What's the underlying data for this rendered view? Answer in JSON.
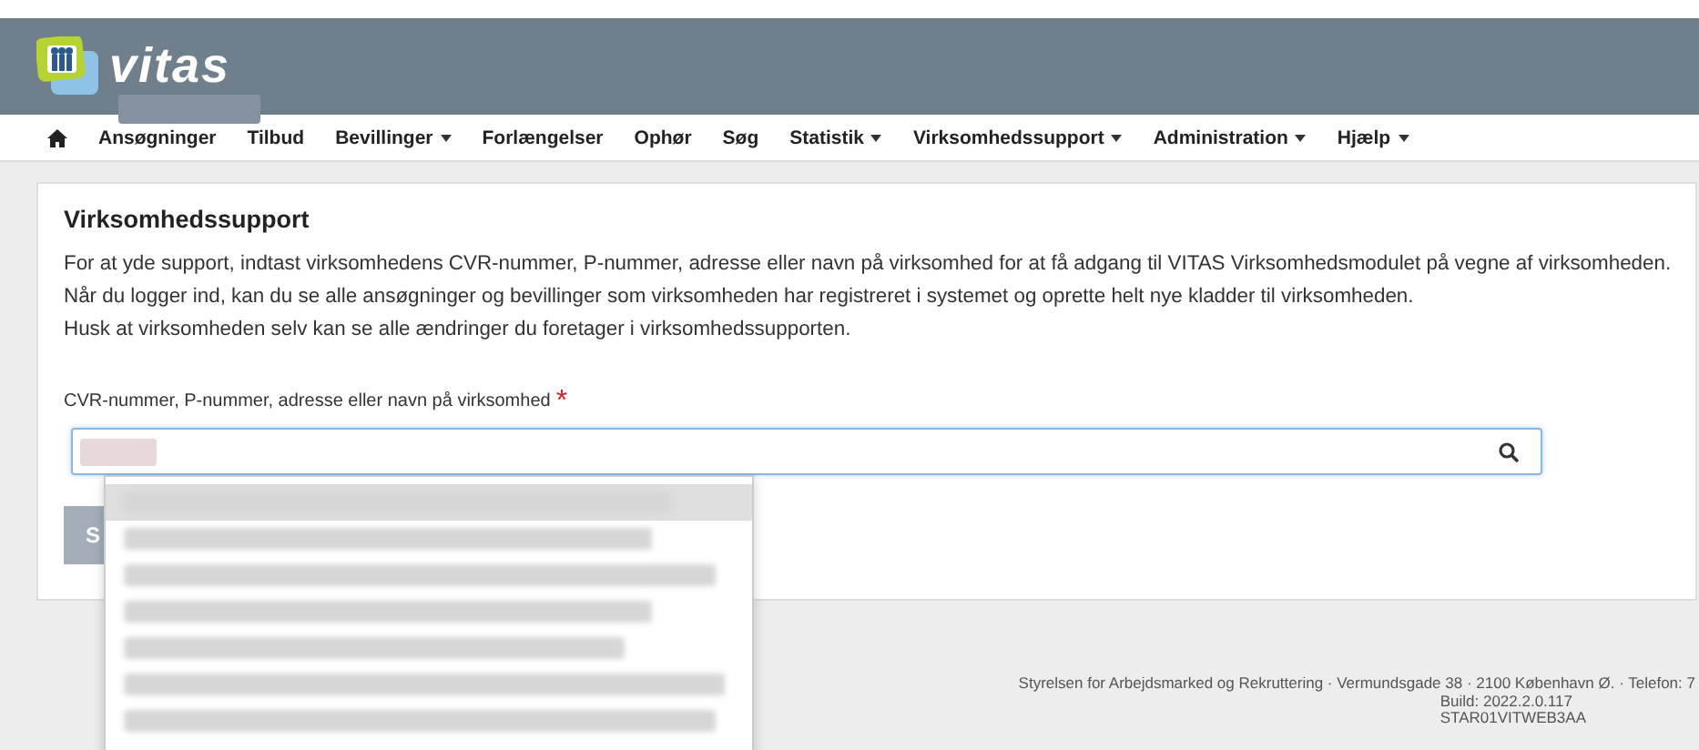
{
  "header": {
    "logo_text": "vitas"
  },
  "nav": [
    {
      "label": "Ansøgninger",
      "dropdown": false
    },
    {
      "label": "Tilbud",
      "dropdown": false
    },
    {
      "label": "Bevillinger",
      "dropdown": true
    },
    {
      "label": "Forlængelser",
      "dropdown": false
    },
    {
      "label": "Ophør",
      "dropdown": false
    },
    {
      "label": "Søg",
      "dropdown": false
    },
    {
      "label": "Statistik",
      "dropdown": true
    },
    {
      "label": "Virksomhedssupport",
      "dropdown": true
    },
    {
      "label": "Administration",
      "dropdown": true
    },
    {
      "label": "Hjælp",
      "dropdown": true
    }
  ],
  "card": {
    "title": "Virksomhedssupport",
    "paragraphs": [
      "For at yde support, indtast virksomhedens CVR-nummer, P-nummer, adresse eller navn på virksomhed for at få adgang til VITAS Virksomhedsmodulet på vegne af virksomheden.",
      "Når du logger ind, kan du se alle ansøgninger og bevillinger som virksomheden har registreret i systemet og oprette helt nye kladder til virksomheden.",
      "Husk at virksomheden selv kan se alle ændringer du foretager i virksomhedssupporten."
    ],
    "field": {
      "label": "CVR-nummer, P-nummer, adresse eller navn på virksomhed",
      "required_mark": "*"
    },
    "button": {
      "label": "S"
    }
  },
  "suggestions": [
    {
      "selected": true
    },
    {
      "selected": false
    },
    {
      "selected": false
    },
    {
      "selected": false
    },
    {
      "selected": false
    },
    {
      "selected": false
    },
    {
      "selected": false
    }
  ],
  "footer": {
    "address": "Styrelsen for Arbejdsmarked og Rekruttering · Vermundsgade 38 · 2100 København Ø. · Telefon: 7",
    "build": "Build: 2022.2.0.117",
    "server": "STAR01VITWEB3AA"
  }
}
